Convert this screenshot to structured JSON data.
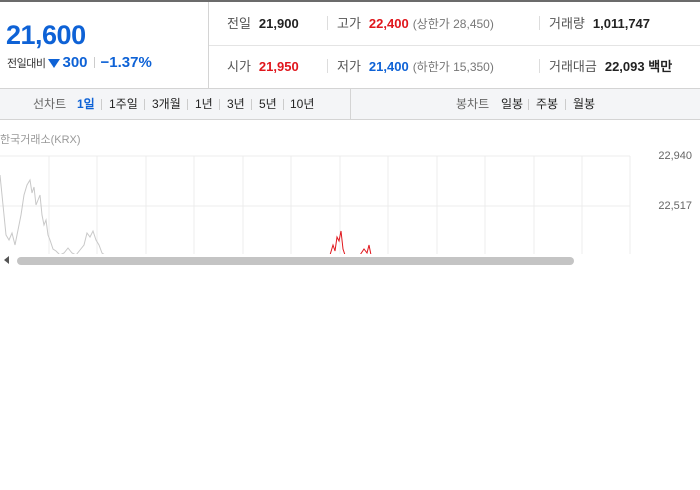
{
  "quote": {
    "price": "21,600",
    "change_label": "전일대비",
    "change_value": "300",
    "change_pct": "−1.37%"
  },
  "stats": {
    "prev_close_label": "전일",
    "prev_close": "21,900",
    "high_label": "고가",
    "high": "22,400",
    "upper_limit": "(상한가 28,450)",
    "volume_label": "거래량",
    "volume": "1,011,747",
    "open_label": "시가",
    "open": "21,950",
    "low_label": "저가",
    "low": "21,400",
    "lower_limit": "(하한가 15,350)",
    "amount_label": "거래대금",
    "amount": "22,093",
    "amount_unit": "백만"
  },
  "tabs": {
    "line_label": "선차트",
    "line_items": [
      "1일",
      "1주일",
      "3개월",
      "1년",
      "3년",
      "5년",
      "10년"
    ],
    "candle_label": "봉차트",
    "candle_items": [
      "일봉",
      "주봉",
      "월봉"
    ]
  },
  "chart": {
    "source": "한국거래소(KRX)",
    "y_labels": [
      "22,940",
      "22,517"
    ]
  },
  "colors": {
    "up": "#e0161c",
    "down": "#0e62d6"
  }
}
